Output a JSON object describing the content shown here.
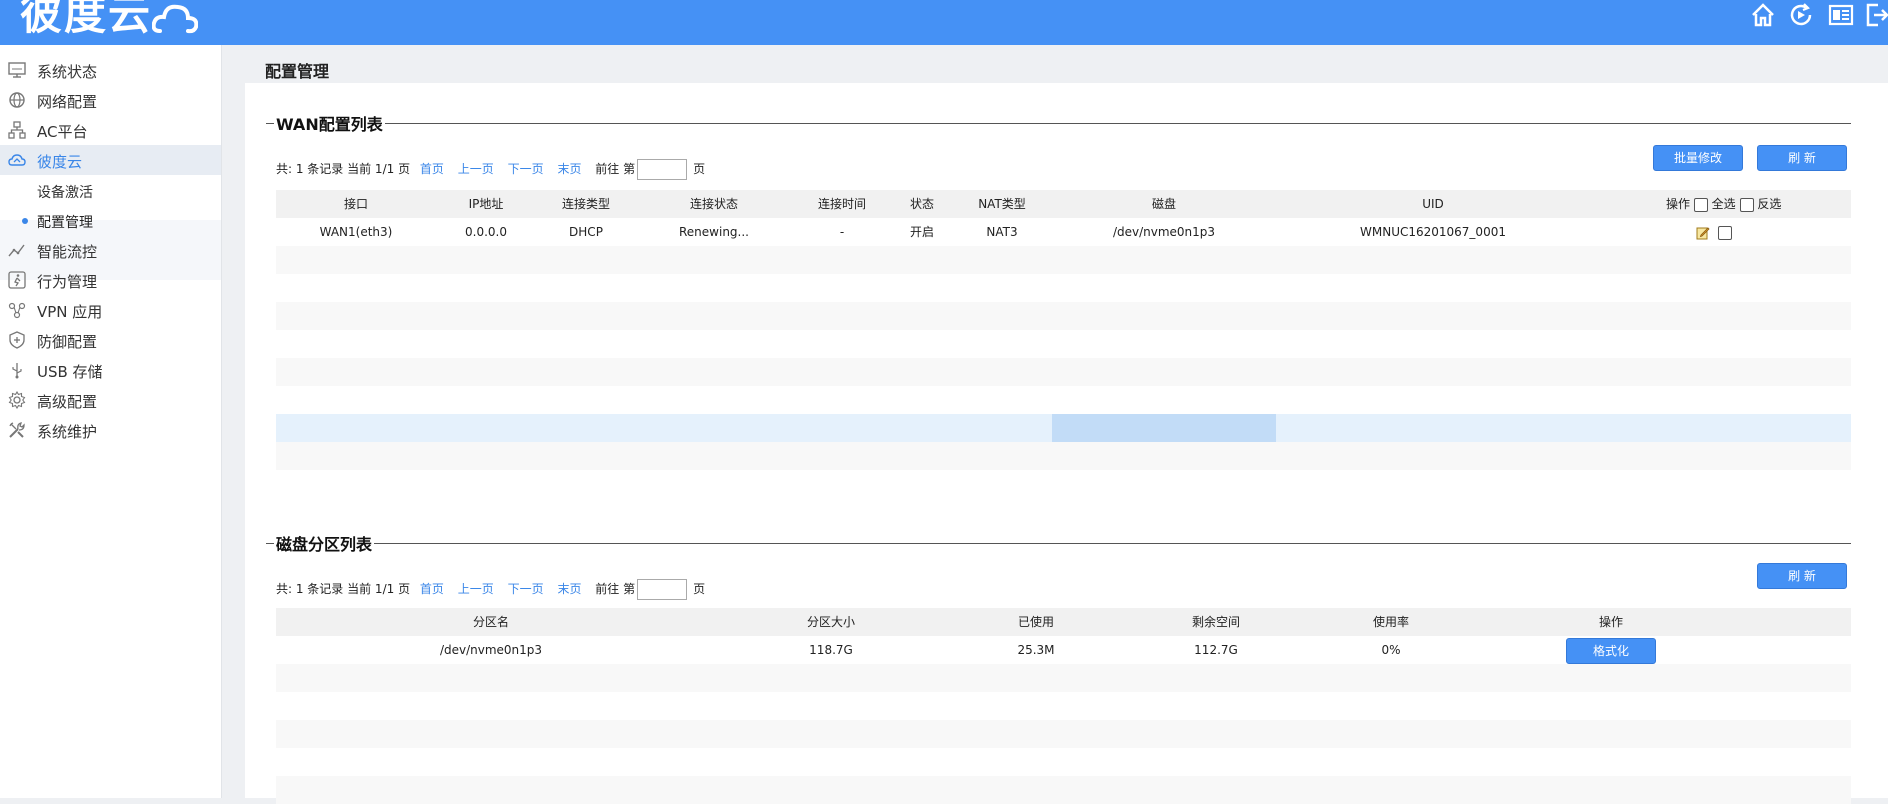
{
  "header": {
    "logo_text": "彼度云",
    "icons": [
      "home-icon",
      "refresh-play-icon",
      "panel-icon",
      "logout-icon"
    ]
  },
  "sidebar": {
    "items": [
      {
        "label": "系统状态",
        "icon": "monitor-icon"
      },
      {
        "label": "网络配置",
        "icon": "globe-icon"
      },
      {
        "label": "AC平台",
        "icon": "network-tree-icon"
      },
      {
        "label": "彼度云",
        "icon": "cloud-icon",
        "active": true
      },
      {
        "label": "智能流控",
        "icon": "trend-icon"
      },
      {
        "label": "行为管理",
        "icon": "behavior-icon"
      },
      {
        "label": "VPN 应用",
        "icon": "vpn-icon"
      },
      {
        "label": "防御配置",
        "icon": "shield-icon"
      },
      {
        "label": "USB 存储",
        "icon": "usb-icon"
      },
      {
        "label": "高级配置",
        "icon": "gear-icon"
      },
      {
        "label": "系统维护",
        "icon": "tools-icon"
      }
    ],
    "sub_items": [
      {
        "label": "设备激活"
      },
      {
        "label": "配置管理",
        "current": true
      }
    ]
  },
  "page": {
    "title": "配置管理"
  },
  "wan": {
    "section_title": "WAN配置列表",
    "pager": {
      "summary": "共: 1 条记录 当前 1/1 页",
      "first": "首页",
      "prev": "上一页",
      "next": "下一页",
      "last": "末页",
      "goto_prefix": "前往 第",
      "goto_suffix": "页",
      "page_input": ""
    },
    "batch_button": "批量修改",
    "refresh_button": "刷 新",
    "columns": [
      "接口",
      "IP地址",
      "连接类型",
      "连接状态",
      "连接时间",
      "状态",
      "NAT类型",
      "磁盘",
      "UID"
    ],
    "ops_header": "操作",
    "select_all": "全选",
    "invert_select": "反选",
    "rows": [
      [
        "WAN1(eth3)",
        "0.0.0.0",
        "DHCP",
        "Renewing...",
        "-",
        "开启",
        "NAT3",
        "/dev/nvme0n1p3",
        "WMNUC16201067_0001"
      ]
    ]
  },
  "disk": {
    "section_title": "磁盘分区列表",
    "pager": {
      "summary": "共: 1 条记录 当前 1/1 页",
      "first": "首页",
      "prev": "上一页",
      "next": "下一页",
      "last": "末页",
      "goto_prefix": "前往 第",
      "goto_suffix": "页",
      "page_input": ""
    },
    "refresh_button": "刷 新",
    "columns": [
      "分区名",
      "分区大小",
      "已使用",
      "剩余空间",
      "使用率",
      "操作"
    ],
    "rows": [
      {
        "name": "/dev/nvme0n1p3",
        "size": "118.7G",
        "used": "25.3M",
        "free": "112.7G",
        "usage": "0%",
        "action": "格式化"
      }
    ]
  },
  "colors": {
    "header": "#4591f5",
    "accent": "#3a86e8",
    "active_bg": "#e7ecf3"
  }
}
